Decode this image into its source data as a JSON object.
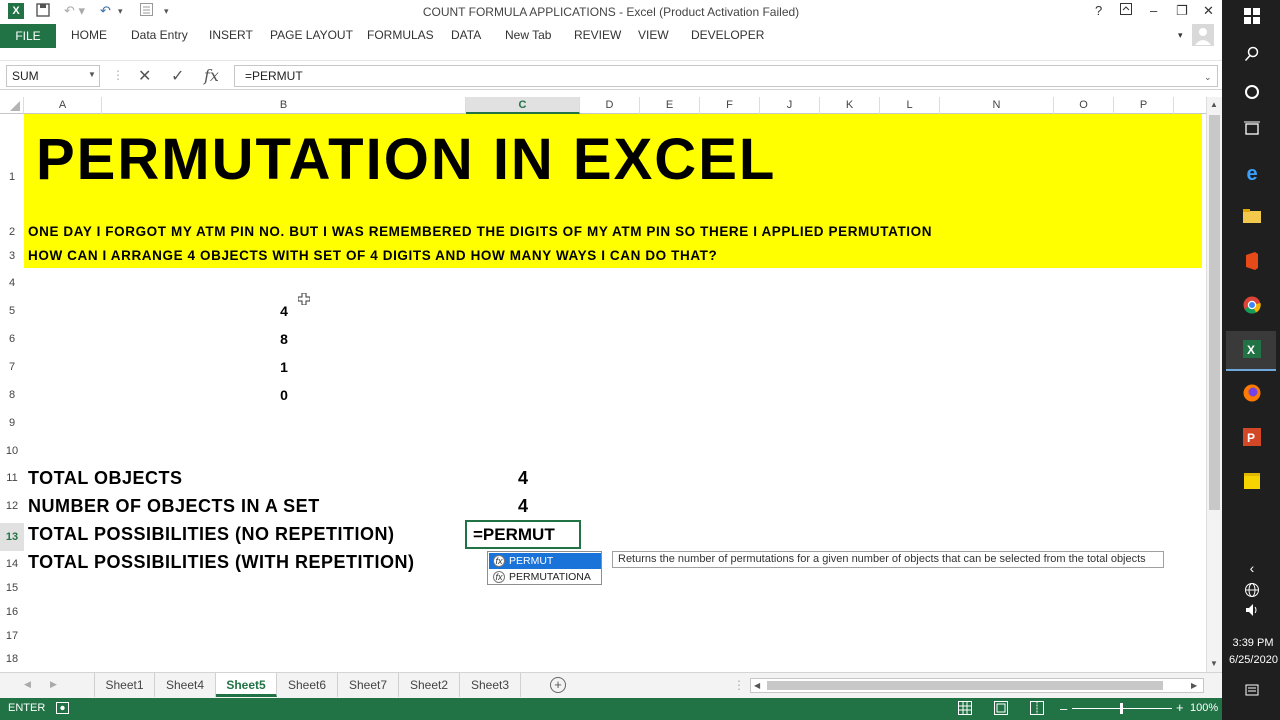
{
  "window": {
    "title": "COUNT FORMULA APPLICATIONS - Excel (Product Activation Failed)",
    "help": "?",
    "app_logo": "X"
  },
  "ribbon": {
    "file": "FILE",
    "tabs": [
      "HOME",
      "Data Entry",
      "INSERT",
      "PAGE LAYOUT",
      "FORMULAS",
      "DATA",
      "New Tab",
      "REVIEW",
      "VIEW",
      "DEVELOPER"
    ]
  },
  "formula_bar": {
    "name_box": "SUM",
    "fx_label": "fx",
    "content": "=PERMUT"
  },
  "columns": [
    "A",
    "B",
    "C",
    "D",
    "E",
    "F",
    "J",
    "K",
    "L",
    "N",
    "O",
    "P"
  ],
  "rows": [
    "1",
    "2",
    "3",
    "4",
    "5",
    "6",
    "7",
    "8",
    "9",
    "10",
    "11",
    "12",
    "13",
    "14",
    "15",
    "16",
    "17",
    "18"
  ],
  "sheet": {
    "title": "PERMUTATION IN EXCEL",
    "line2": "ONE DAY I FORGOT MY ATM PIN NO. BUT I WAS REMEMBERED THE DIGITS OF MY ATM PIN SO THERE I APPLIED PERMUTATION",
    "line3": "HOW CAN I ARRANGE 4 OBJECTS WITH SET OF 4 DIGITS AND HOW MANY WAYS I CAN DO THAT?",
    "digits": [
      "4",
      "8",
      "1",
      "0"
    ],
    "labels": {
      "total_objects": "TOTAL OBJECTS",
      "objects_in_set": "NUMBER OF OBJECTS IN A SET",
      "no_repetition": "TOTAL POSSIBILITIES (NO REPETITION)",
      "with_repetition": "TOTAL POSSIBILITIES (WITH REPETITION)"
    },
    "values": {
      "total_objects": "4",
      "objects_in_set": "4"
    },
    "active_cell_text": "=PERMUT"
  },
  "autocomplete": {
    "items": [
      "PERMUT",
      "PERMUTATIONA"
    ],
    "tooltip": "Returns the number of permutations for a given number of objects that can be selected from the total objects"
  },
  "sheet_tabs": [
    "Sheet1",
    "Sheet4",
    "Sheet5",
    "Sheet6",
    "Sheet7",
    "Sheet2",
    "Sheet3"
  ],
  "active_sheet": "Sheet5",
  "status": {
    "mode": "ENTER",
    "zoom": "100%"
  },
  "taskbar": {
    "time": "3:39 PM",
    "date": "6/25/2020"
  },
  "colors": {
    "excel_green": "#217346",
    "banner_yellow": "#ffff00"
  }
}
